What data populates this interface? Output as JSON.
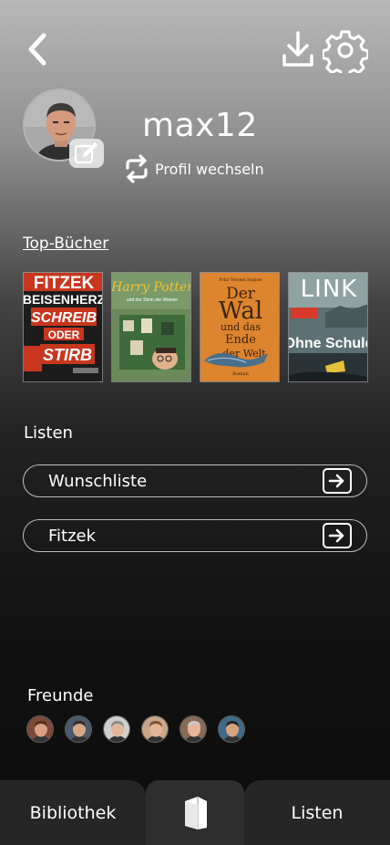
{
  "header": {
    "back_icon": "chevron-left-icon",
    "download_icon": "download-icon",
    "settings_icon": "gear-icon"
  },
  "profile": {
    "username": "max12",
    "switch_label": "Profil wechseln",
    "edit_icon": "edit-icon",
    "switch_icon": "repeat-icon"
  },
  "top_books": {
    "label": "Top-Bücher",
    "books": [
      {
        "title_lines": [
          "FITZEK",
          "BEISENHERZ",
          "SCHREIB",
          "ODER",
          "STIRB"
        ],
        "colors": {
          "bg": "#c8361f",
          "text": "#ffffff"
        }
      },
      {
        "title": "Harry Potter",
        "subtitle": "und der Stein der Weisen",
        "colors": {
          "bg": "#6a8a5a",
          "text": "#f1c232"
        }
      },
      {
        "author": "Fritz Torsten Sogner",
        "title_lines": [
          "Der",
          "Wal",
          "und das",
          "Ende",
          "der Welt"
        ],
        "colors": {
          "bg": "#e08a33",
          "text": "#3a2410"
        }
      },
      {
        "title": "LINK",
        "subtitle": "Ohne Schuld",
        "colors": {
          "bg": "#5c7173",
          "text": "#ffffff"
        }
      }
    ]
  },
  "lists": {
    "label": "Listen",
    "items": [
      {
        "label": "Wunschliste",
        "icon": "arrow-right-box-icon"
      },
      {
        "label": "Fitzek",
        "icon": "arrow-right-box-icon"
      }
    ]
  },
  "friends": {
    "label": "Freunde",
    "avatars": [
      {
        "skin": "#d9a084",
        "hair": "#5a2e1c",
        "bg": "#7a4a3a"
      },
      {
        "skin": "#d7a789",
        "hair": "#3a2b22",
        "bg": "#4a5a6e"
      },
      {
        "skin": "#e3b69a",
        "hair": "#8a8a8a",
        "bg": "#cfcfcf"
      },
      {
        "skin": "#e4b49a",
        "hair": "#7a5238",
        "bg": "#c9a68a"
      },
      {
        "skin": "#e8b49c",
        "hair": "#c9c9c9",
        "bg": "#8a6a55"
      },
      {
        "skin": "#d9a27f",
        "hair": "#2a2420",
        "bg": "#3e6b8a"
      }
    ]
  },
  "tabbar": {
    "left": "Bibliothek",
    "center_icon": "book-icon",
    "right": "Listen"
  }
}
